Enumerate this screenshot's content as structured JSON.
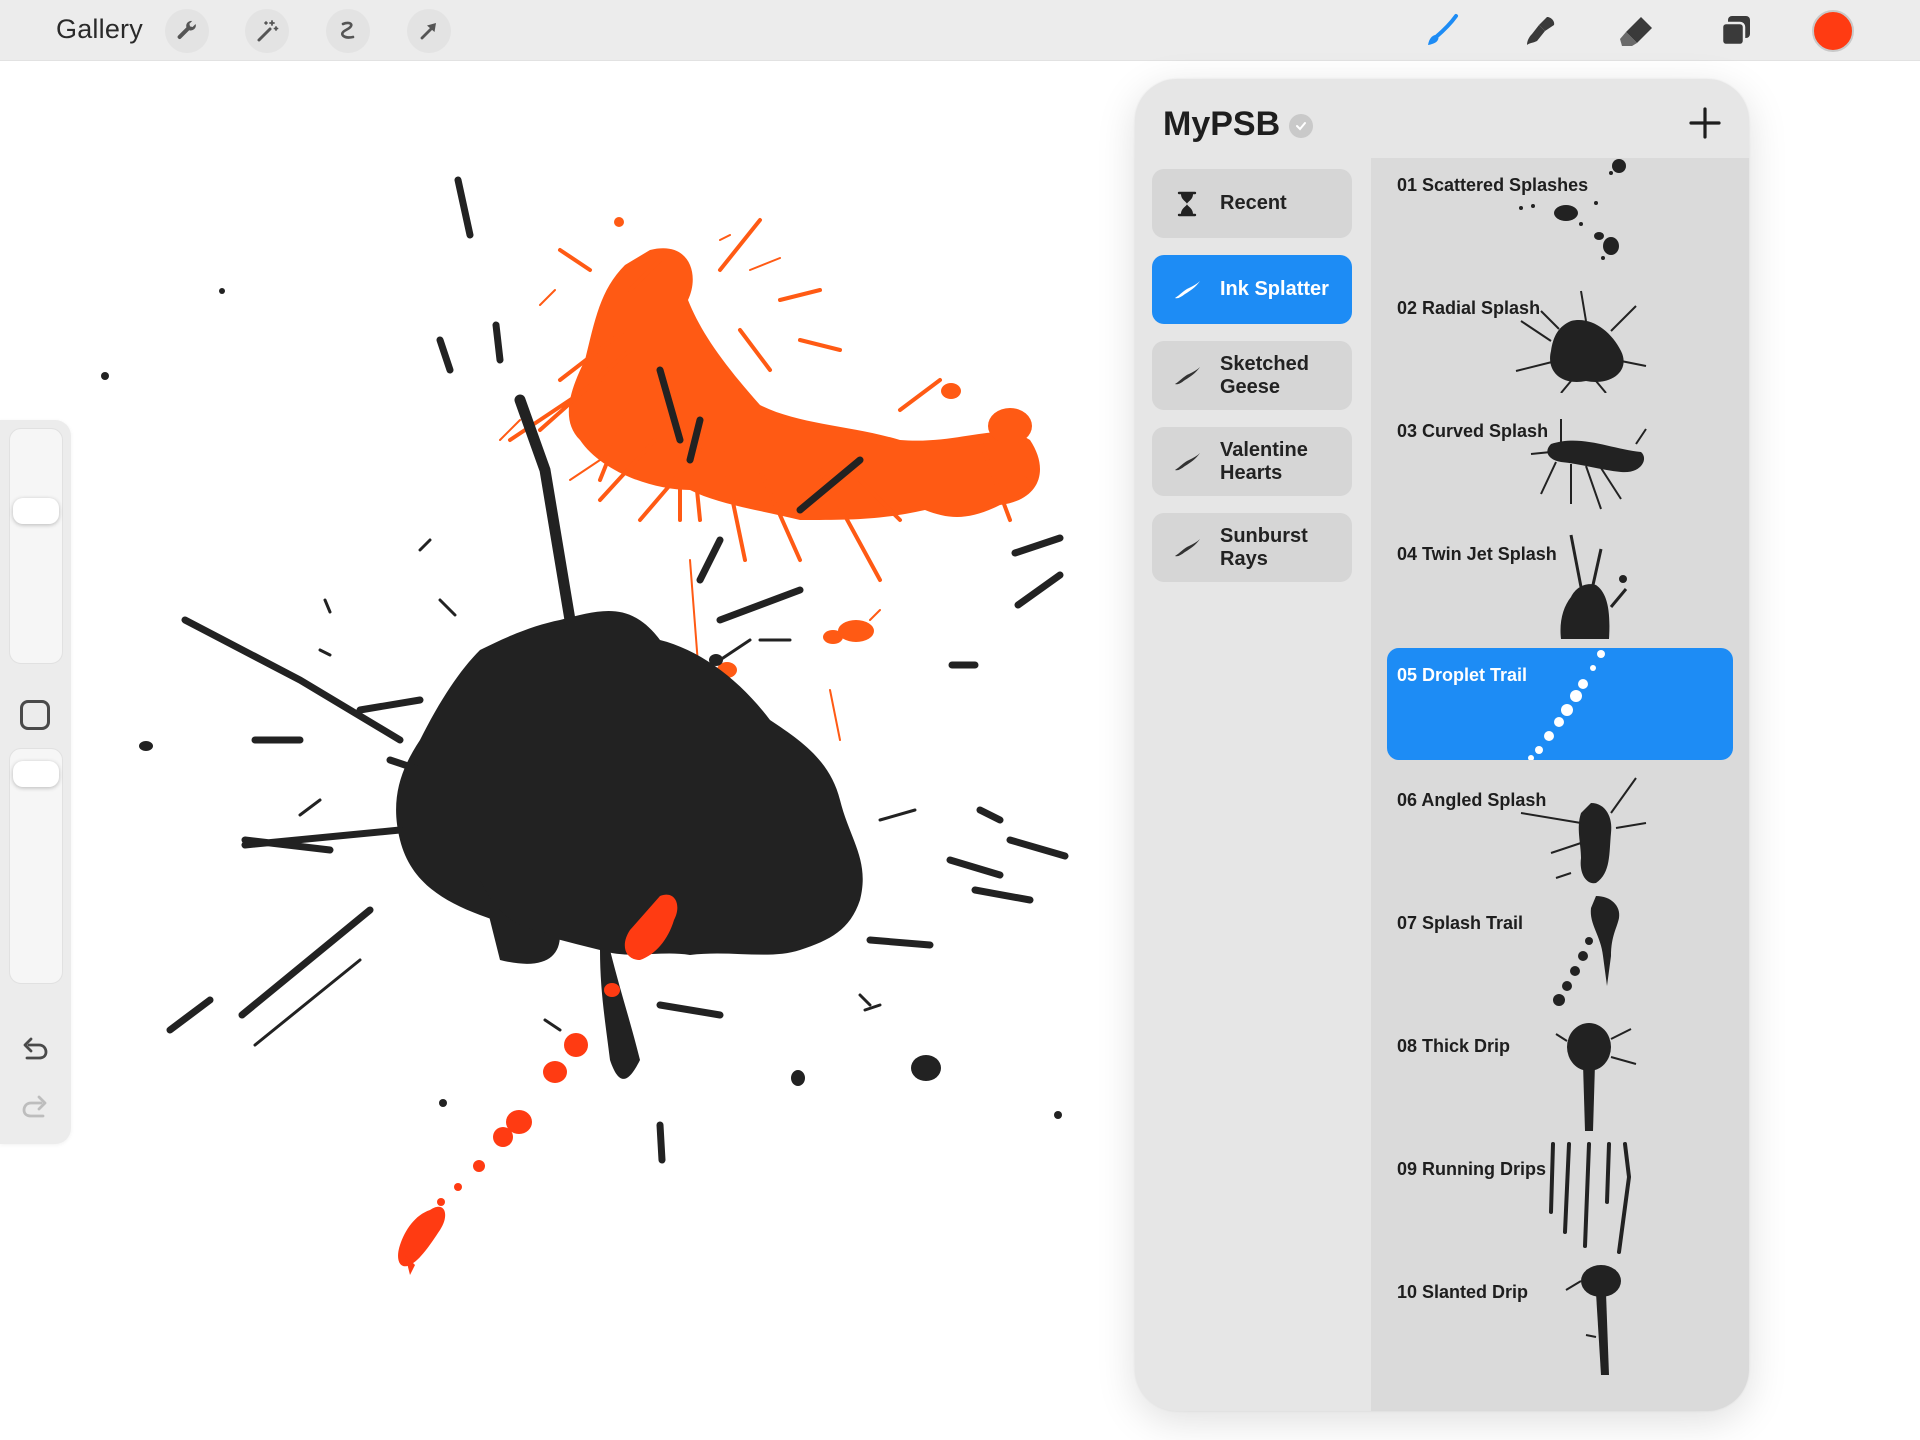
{
  "toolbar": {
    "gallery_label": "Gallery",
    "left_tools": [
      "wrench-icon",
      "magic-wand-icon",
      "selection-icon",
      "transform-arrow-icon"
    ],
    "right_tools": [
      "brush-icon",
      "smudge-icon",
      "eraser-icon",
      "layers-icon"
    ],
    "current_color": "#ff3b12"
  },
  "sidebar": {
    "size_level": 0.68,
    "opacity_level": 0.96,
    "icons": [
      "modify-square-icon",
      "undo-icon",
      "redo-icon"
    ]
  },
  "brush_library": {
    "title": "MyPSB",
    "add_icon": "plus-icon",
    "sets": [
      {
        "label": "Recent",
        "icon": "hourglass-icon",
        "active": false
      },
      {
        "label": "Ink Splatter",
        "icon": "brush-stroke-icon",
        "active": true
      },
      {
        "label": "Sketched\nGeese",
        "icon": "brush-stroke-icon",
        "active": false
      },
      {
        "label": "Valentine\nHearts",
        "icon": "brush-stroke-icon",
        "active": false
      },
      {
        "label": "Sunburst\nRays",
        "icon": "brush-stroke-icon",
        "active": false
      }
    ],
    "brushes": [
      {
        "name": "01 Scattered Splashes",
        "active": false
      },
      {
        "name": "02 Radial Splash",
        "active": false
      },
      {
        "name": "03 Curved Splash",
        "active": false
      },
      {
        "name": "04 Twin Jet Splash",
        "active": false
      },
      {
        "name": "05 Droplet Trail",
        "active": true
      },
      {
        "name": "06 Angled Splash",
        "active": false
      },
      {
        "name": "07 Splash Trail",
        "active": false
      },
      {
        "name": "08 Thick Drip",
        "active": false
      },
      {
        "name": "09 Running Drips",
        "active": false
      },
      {
        "name": "10 Slanted Drip",
        "active": false
      }
    ]
  },
  "colors": {
    "accent": "#1d8cf5",
    "ink": "#222222",
    "orange_paint": "#ff5a14",
    "red_paint": "#ff3b12"
  }
}
